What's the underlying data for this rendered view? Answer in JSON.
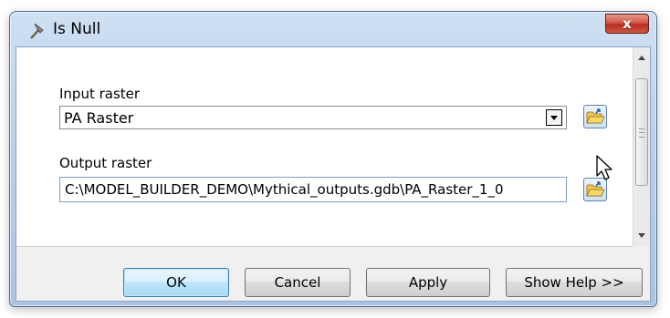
{
  "window": {
    "title": "Is Null",
    "close_label": "x"
  },
  "form": {
    "input_raster_label": "Input raster",
    "input_raster_value": "PA Raster",
    "output_raster_label": "Output raster",
    "output_raster_value": "C:\\MODEL_BUILDER_DEMO\\Mythical_outputs.gdb\\PA_Raster_1_0"
  },
  "buttons": {
    "ok": "OK",
    "cancel": "Cancel",
    "apply": "Apply",
    "show_help": "Show Help >>"
  },
  "icons": {
    "title": "hammer-icon",
    "browse": "open-folder-icon",
    "cursor": "arrow-cursor-icon"
  },
  "colors": {
    "frame": "#b9d0ea",
    "close_button": "#c8443a",
    "default_button": "#bee6fd"
  }
}
